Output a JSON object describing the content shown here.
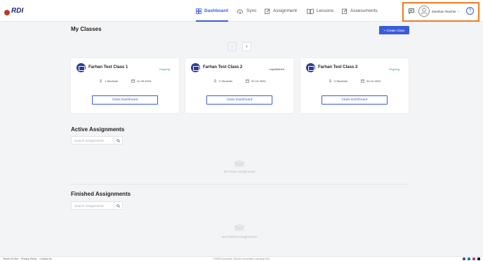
{
  "header": {
    "logo_text": "RDI",
    "nav": [
      {
        "label": "Dashboard",
        "icon": "grid-icon",
        "active": true
      },
      {
        "label": "Sync",
        "icon": "cloud-sync-icon",
        "active": false
      },
      {
        "label": "Assignment",
        "icon": "edit-icon",
        "active": false
      },
      {
        "label": "Lessons",
        "icon": "book-icon",
        "active": false
      },
      {
        "label": "Assessments",
        "icon": "edit-icon",
        "active": false
      }
    ],
    "user_name": "Zeeshan Teacher",
    "help_label": "?"
  },
  "my_classes": {
    "title": "My Classes",
    "create_label": "+ Create Class",
    "pager_prev": "‹",
    "pager_next": "›",
    "cards": [
      {
        "title": "Farhan Test Class 1",
        "status": "Ongoing",
        "students": "1 Students",
        "date": "11-09-2024",
        "button": "Class Dashboard"
      },
      {
        "title": "Farhan Test Class 2",
        "status": "unpublished",
        "students": "0 Students",
        "date": "02-10-2024",
        "button": "Class Dashboard"
      },
      {
        "title": "Farhan Test Class 3",
        "status": "Ongoing",
        "students": "0 Students",
        "date": "02-10-2024",
        "button": "Class Dashboard"
      }
    ]
  },
  "active_assignments": {
    "title": "Active Assignments",
    "search_placeholder": "Search assignments",
    "empty_text": "No Active Assignments"
  },
  "finished_assignments": {
    "title": "Finished Assignments",
    "search_placeholder": "Search assignments",
    "empty_text": "No Finished Assignments"
  },
  "footer": {
    "links": [
      "Terms Of Use",
      "Privacy Policy",
      "Contact us"
    ],
    "copyright": "©2025 Accuread. Dictum Innovation Learning Hub"
  },
  "colors": {
    "accent": "#3b5bdb",
    "highlight_border": "#f07a22",
    "ongoing": "#2e9e5b"
  }
}
